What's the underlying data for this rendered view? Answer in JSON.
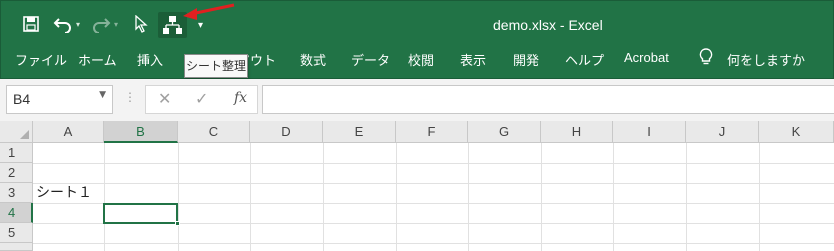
{
  "window": {
    "title": "demo.xlsx  -  Excel"
  },
  "qat": {
    "icons": [
      "save-icon",
      "undo-icon",
      "redo-icon",
      "select-pointer-icon",
      "sheet-organize-icon",
      "customize-qat-icon"
    ],
    "colors": {
      "ribbon": "#217346",
      "active_outline": "#217346",
      "annotation_arrow": "#e02020"
    }
  },
  "tooltip": {
    "text": "シート整理"
  },
  "ribbon": {
    "tabs": [
      "ファイル",
      "ホーム",
      "挿入",
      "アウト",
      "数式",
      "データ",
      "校閲",
      "表示",
      "開発",
      "ヘルプ",
      "Acrobat"
    ],
    "tellme_label": "何をしますか"
  },
  "formula_bar": {
    "name_box": "B4",
    "cancel_glyph": "✕",
    "enter_glyph": "✓",
    "fx_label": "fx",
    "formula_value": ""
  },
  "sheet": {
    "columns": [
      "A",
      "B",
      "C",
      "D",
      "E",
      "F",
      "G",
      "H",
      "I",
      "J",
      "K"
    ],
    "rows": [
      "1",
      "2",
      "3",
      "4",
      "5"
    ],
    "selected_cell": "B4",
    "cells": {
      "A3": "シート１"
    }
  }
}
